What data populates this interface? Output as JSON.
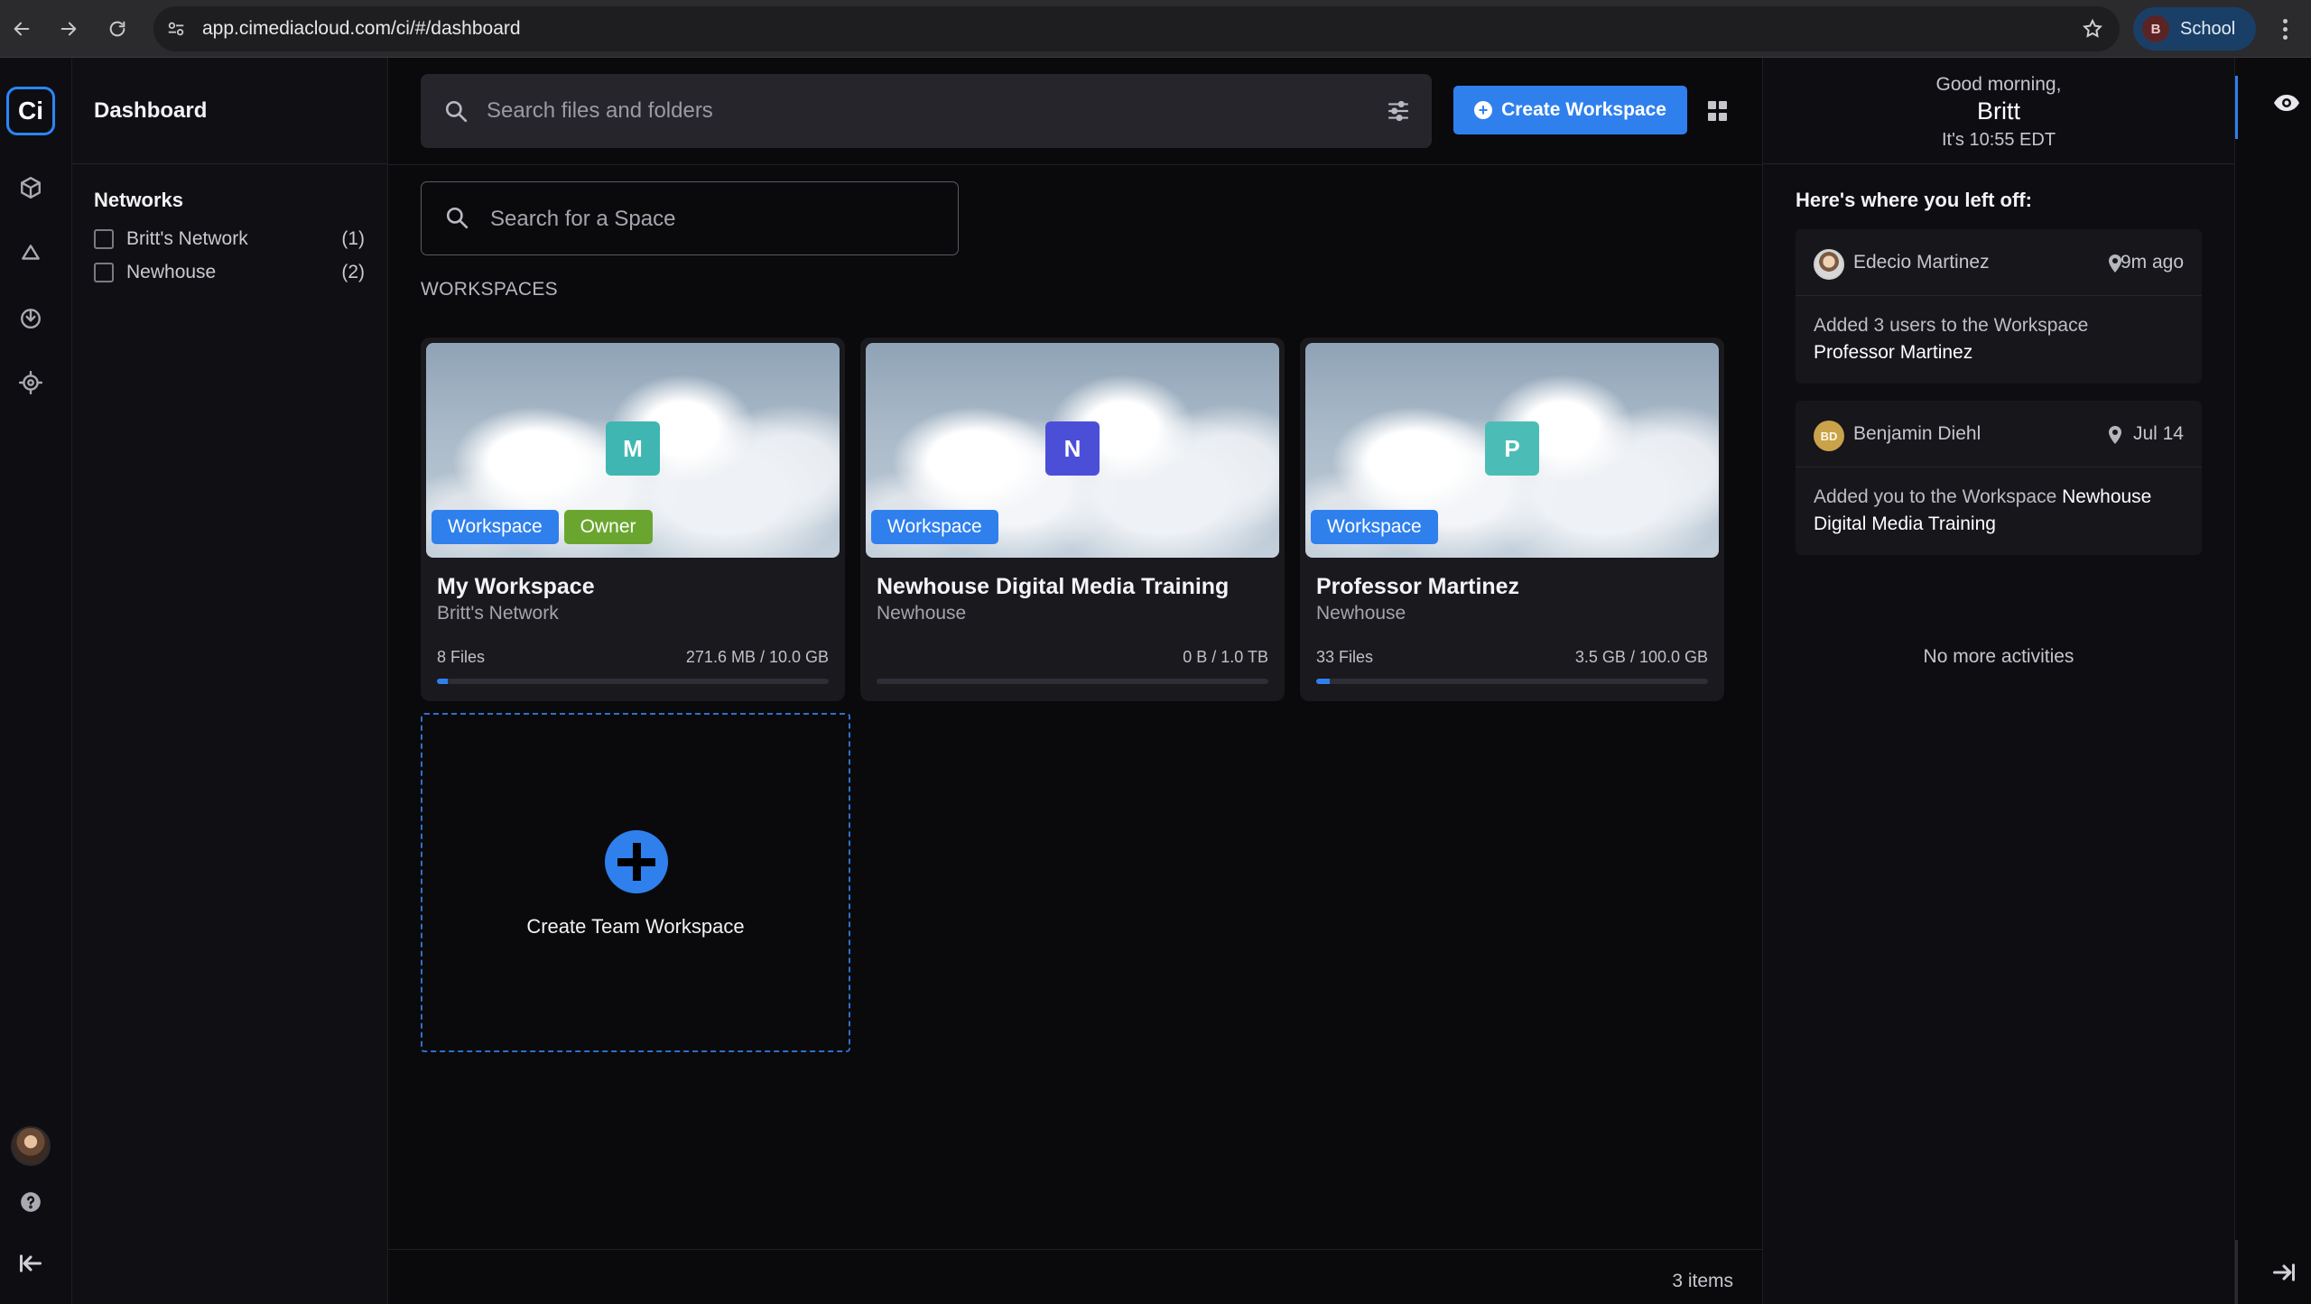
{
  "browser": {
    "url": "app.cimediacloud.com/ci/#/dashboard",
    "profile_initial": "B",
    "profile_label": "School"
  },
  "rail": {
    "logo_text": "Ci",
    "icons": [
      "cube-icon",
      "cloud-icon",
      "download-icon",
      "target-icon",
      "help-icon",
      "collapse-icon"
    ]
  },
  "panel": {
    "title": "Dashboard",
    "networks_heading": "Networks",
    "networks": [
      {
        "label": "Britt's Network",
        "count": "(1)"
      },
      {
        "label": "Newhouse",
        "count": "(2)"
      }
    ]
  },
  "main": {
    "search_placeholder": "Search files and folders",
    "create_workspace_label": "Create Workspace",
    "space_search_placeholder": "Search for a Space",
    "section_label": "WORKSPACES",
    "workspaces": [
      {
        "letter": "M",
        "letter_color": "#3fb6b2",
        "tags": [
          "Workspace",
          "Owner"
        ],
        "name": "My Workspace",
        "network": "Britt's Network",
        "files": "8 Files",
        "size": "271.6 MB / 10.0 GB",
        "usage": 0.027
      },
      {
        "letter": "N",
        "letter_color": "#4b4fd8",
        "tags": [
          "Workspace"
        ],
        "name": "Newhouse Digital Media Training",
        "network": "Newhouse",
        "files": "",
        "size": "0 B / 1.0 TB",
        "usage": 0
      },
      {
        "letter": "P",
        "letter_color": "#4cbdb6",
        "tags": [
          "Workspace"
        ],
        "name": "Professor Martinez",
        "network": "Newhouse",
        "files": "33 Files",
        "size": "3.5 GB / 100.0 GB",
        "usage": 0.035
      }
    ],
    "create_team_label": "Create Team Workspace",
    "items_count": "3 items"
  },
  "activity": {
    "greeting": "Good morning,",
    "name": "Britt",
    "time": "It's 10:55 EDT",
    "left_off_heading": "Here's where you left off:",
    "items": [
      {
        "user": "Edecio Martinez",
        "avatar_initials": "",
        "time": "9m ago",
        "text": "Added 3 users to the Workspace",
        "target": "Professor Martinez"
      },
      {
        "user": "Benjamin Diehl",
        "avatar_initials": "BD",
        "time": "Jul 14",
        "text": "Added you to the Workspace",
        "target": "Newhouse Digital Media Training"
      }
    ],
    "no_more": "No more activities"
  },
  "colors": {
    "accent": "#2f80ed",
    "owner_tag": "#6aa62f"
  }
}
